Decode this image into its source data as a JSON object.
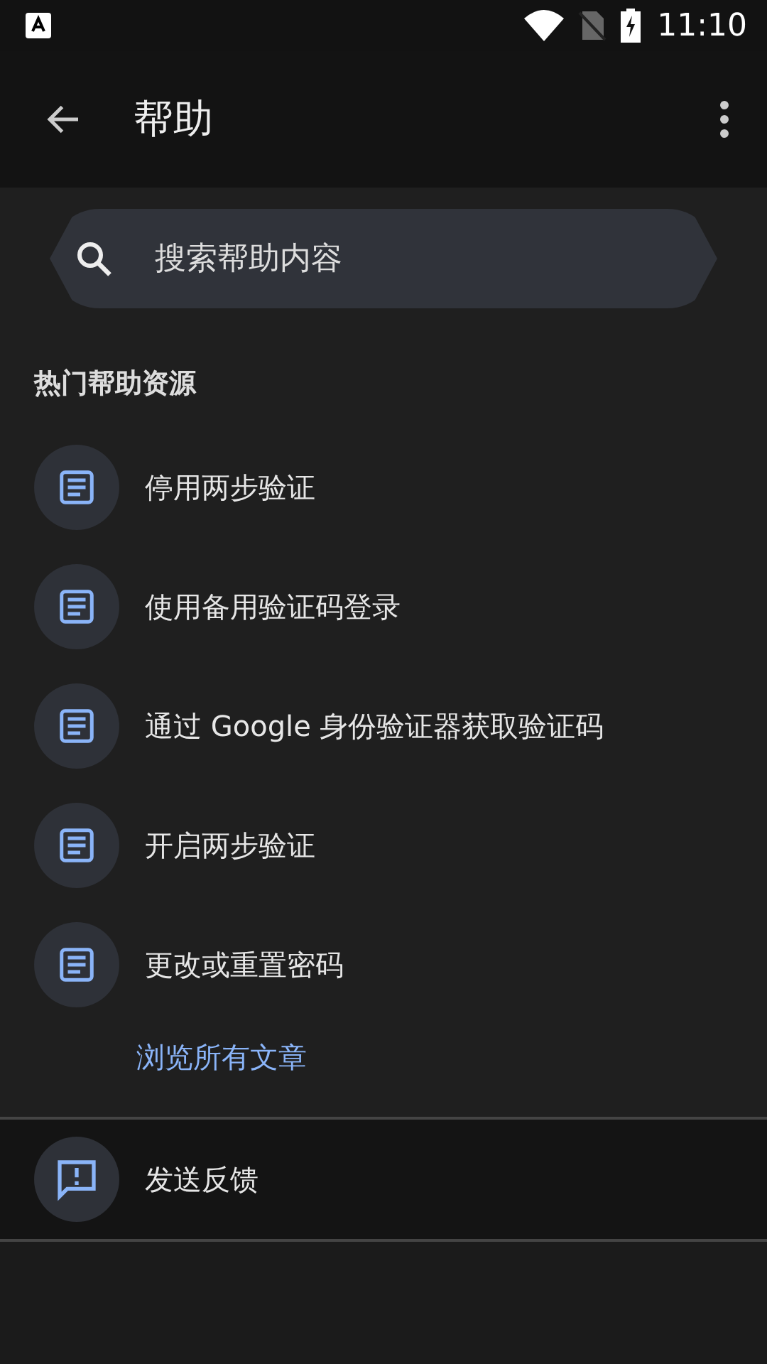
{
  "status_bar": {
    "time": "11:10"
  },
  "app_bar": {
    "title": "帮助"
  },
  "search": {
    "placeholder": "搜索帮助内容"
  },
  "section": {
    "title": "热门帮助资源"
  },
  "articles": [
    {
      "label": "停用两步验证"
    },
    {
      "label": "使用备用验证码登录"
    },
    {
      "label": "通过 Google 身份验证器获取验证码"
    },
    {
      "label": "开启两步验证"
    },
    {
      "label": "更改或重置密码"
    }
  ],
  "browse_link": "浏览所有文章",
  "feedback": {
    "label": "发送反馈"
  }
}
